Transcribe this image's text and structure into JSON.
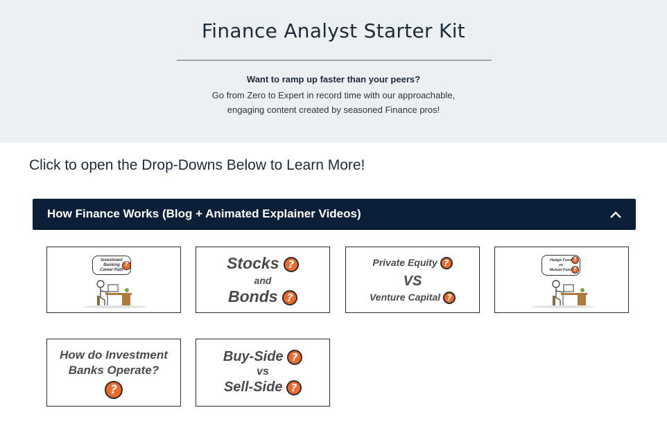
{
  "hero": {
    "title": "Finance Analyst Starter Kit",
    "lead": "Want to ramp up faster than your peers?",
    "sub_line1": "Go from Zero to Expert in record time with our approachable,",
    "sub_line2": "engaging content created by seasoned Finance pros!"
  },
  "instructions": "Click to open the Drop-Downs Below to Learn More!",
  "accordion": {
    "title": "How Finance Works (Blog + Animated Explainer Videos)",
    "state": "expanded",
    "chevron_icon": "chevron-up-icon"
  },
  "cards": {
    "ib_career": {
      "bubble_line1": "Investment",
      "bubble_line2": "Banking",
      "bubble_line3": "Career Path"
    },
    "stocks_bonds": {
      "line1": "Stocks",
      "line2": "and",
      "line3": "Bonds"
    },
    "pe_vc": {
      "line1": "Private Equity",
      "line2": "VS",
      "line3": "Venture Capital"
    },
    "hedge_mutual": {
      "bubble_line1": "Hedge Fund",
      "bubble_line2": "vs",
      "bubble_line3": "Mutual Fund"
    },
    "ib_operate": {
      "line1": "How do Investment",
      "line2": "Banks Operate?"
    },
    "buy_sell": {
      "line1": "Buy-Side",
      "line2": "vs",
      "line3": "Sell-Side"
    }
  },
  "colors": {
    "hero_bg": "#edf0f3",
    "accordion_bg": "#0c1f38",
    "question_badge": "#ec6a2c"
  },
  "question_glyph": "?"
}
